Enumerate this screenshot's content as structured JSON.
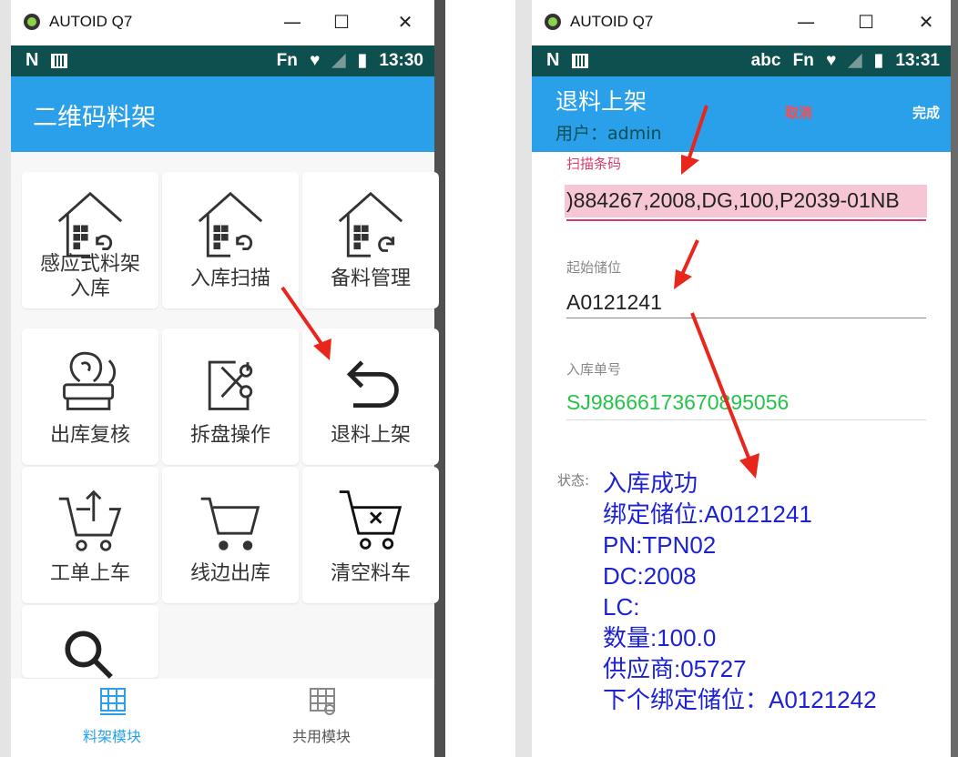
{
  "left": {
    "window_title": "AUTOID Q7",
    "status_bar": {
      "left": "N",
      "fn": "Fn",
      "time": "13:30"
    },
    "app_title": "二维码料架",
    "tiles": [
      {
        "label": "感应式料架\n入库",
        "icon": "house-return-icon"
      },
      {
        "label": "入库扫描",
        "icon": "house-return-icon"
      },
      {
        "label": "备料管理",
        "icon": "house-forward-icon"
      },
      {
        "label": "出库复核",
        "icon": "stamp-icon"
      },
      {
        "label": "拆盘操作",
        "icon": "scissors-icon"
      },
      {
        "label": "退料上架",
        "icon": "undo-arrow-icon"
      },
      {
        "label": "工单上车",
        "icon": "cart-upload-icon"
      },
      {
        "label": "线边出库",
        "icon": "cart-icon"
      },
      {
        "label": "清空料车",
        "icon": "cart-clear-icon"
      },
      {
        "label": "",
        "icon": "search-icon"
      }
    ],
    "bottom_nav": [
      {
        "label": "料架模块",
        "active": true,
        "icon": "rack-module-icon"
      },
      {
        "label": "共用模块",
        "active": false,
        "icon": "shared-module-icon"
      }
    ]
  },
  "right": {
    "window_title": "AUTOID Q7",
    "status_bar": {
      "left": "N",
      "abc": "abc",
      "fn": "Fn",
      "time": "13:31"
    },
    "app_title": "退料上架",
    "user": "用户：admin",
    "cancel_label": "取消",
    "done_label": "完成",
    "fields": {
      "scan_label": "扫描条码",
      "scan_value": ")884267,2008,DG,100,P2039-01NB",
      "start_label": "起始储位",
      "start_value": "A0121241",
      "order_label": "入库单号",
      "order_value": "SJ98666173670895056"
    },
    "status_label": "状态:",
    "status_lines": [
      "入库成功",
      "绑定储位:A0121241",
      "PN:TPN02",
      "DC:2008",
      "LC:",
      "数量:100.0",
      "供应商:05727",
      "下个绑定储位：A0121242"
    ]
  },
  "colors": {
    "appbar": "#2aa0ea",
    "statusbar": "#0e4f4f",
    "scan_highlight": "#f7c6d4",
    "scan_label": "#d63b6a",
    "order_value": "#27c24c",
    "status_text": "#1c22d4",
    "arrow": "#e8261c"
  }
}
